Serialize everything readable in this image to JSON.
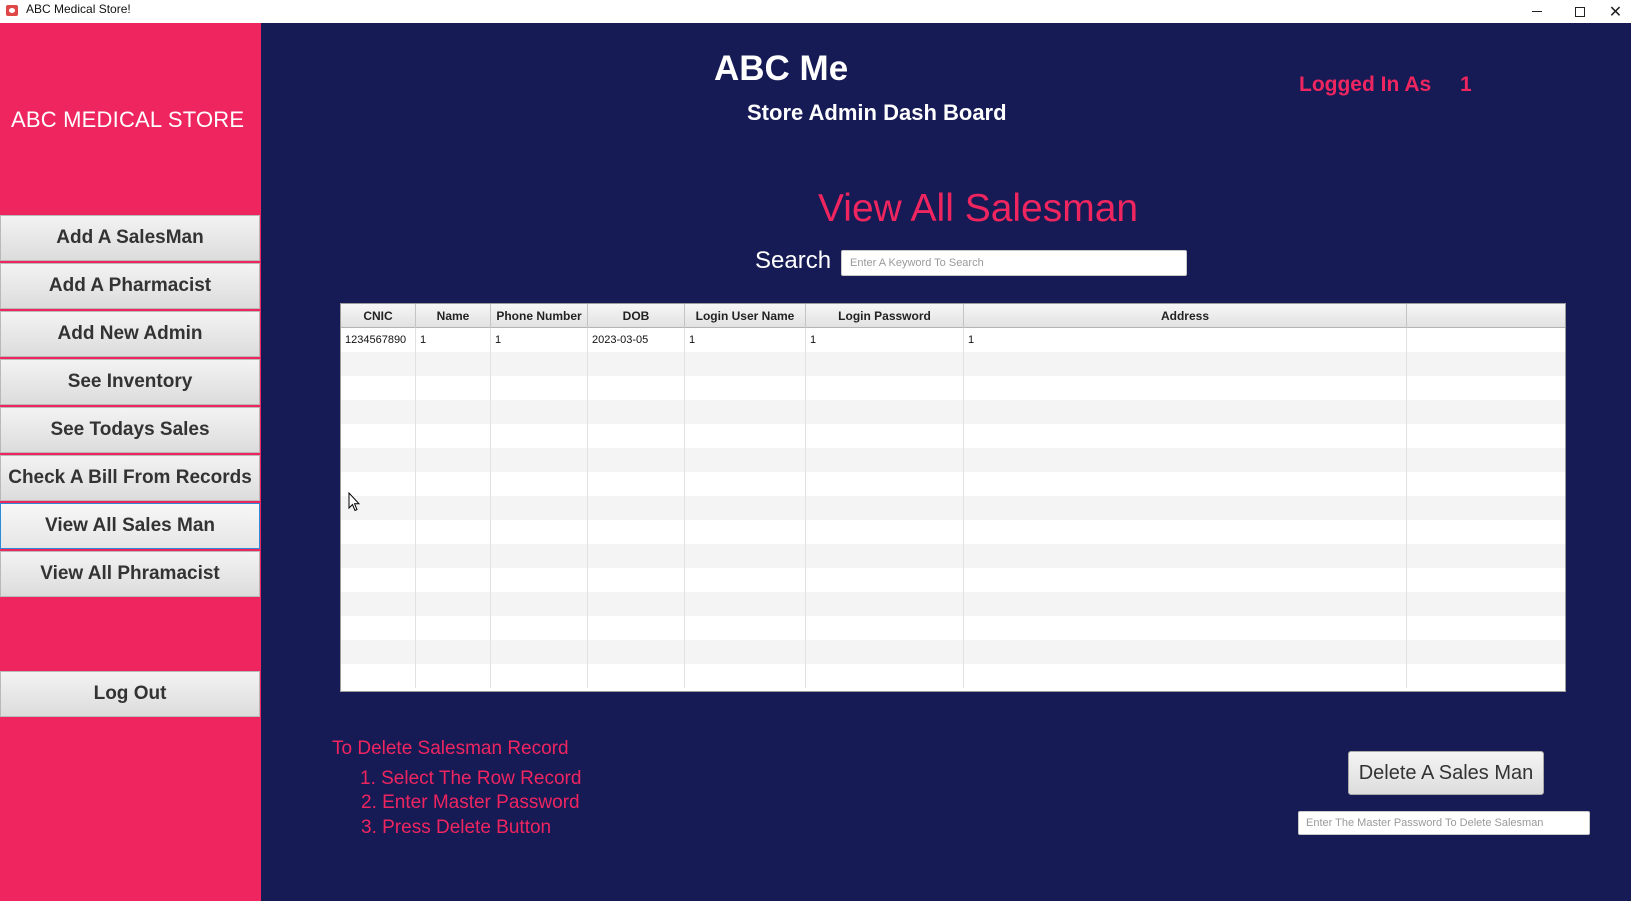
{
  "window": {
    "title": "ABC Medical Store!"
  },
  "sidebar": {
    "brand": "ABC MEDICAL STORE",
    "items": [
      {
        "label": "Add A SalesMan"
      },
      {
        "label": "Add A Pharmacist"
      },
      {
        "label": "Add New Admin"
      },
      {
        "label": "See Inventory"
      },
      {
        "label": "See Todays Sales"
      },
      {
        "label": "Check A Bill From Records"
      },
      {
        "label": "View All Sales Man",
        "active": true
      },
      {
        "label": "View All  Phramacist"
      }
    ],
    "logout": "Log Out"
  },
  "header": {
    "title": "ABC Me",
    "subtitle": "Store Admin Dash Board",
    "logged_label": "Logged In As",
    "logged_user": "1"
  },
  "main": {
    "view_title": "View All Salesman",
    "search_label": "Search",
    "search_placeholder": "Enter A Keyword To Search",
    "search_value": ""
  },
  "table": {
    "columns": [
      "CNIC",
      "Name",
      "Phone Number",
      "DOB",
      "Login User Name",
      "Login Password",
      "Address",
      ""
    ],
    "rows": [
      [
        "1234567890",
        "1",
        "1",
        "2023-03-05",
        "1",
        "1",
        "1",
        ""
      ]
    ],
    "empty_rows": 14
  },
  "instructions": {
    "title": "To Delete Salesman Record",
    "steps": [
      "1. Select The Row Record",
      "2. Enter Master Password",
      "3. Press Delete Button"
    ]
  },
  "delete": {
    "button_label": "Delete A Sales Man",
    "password_placeholder": "Enter The Master Password To Delete Salesman"
  },
  "colors": {
    "sidebar_bg": "#ef2560",
    "main_bg": "#161a55",
    "accent": "#ef2560"
  }
}
